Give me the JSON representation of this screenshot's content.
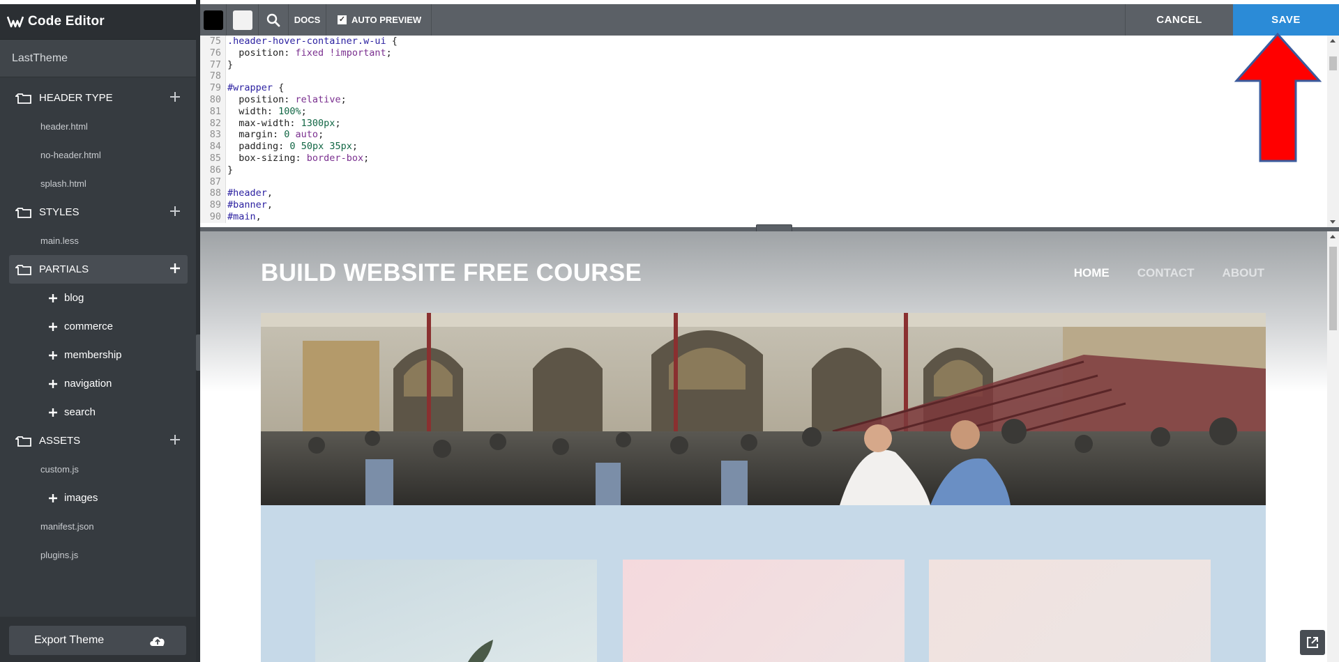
{
  "brand": {
    "title": "Code Editor"
  },
  "sidebar": {
    "theme_name": "LastTheme",
    "sections": [
      {
        "label": "HEADER TYPE",
        "files": [
          "header.html",
          "no-header.html",
          "splash.html"
        ]
      },
      {
        "label": "STYLES",
        "files": [
          "main.less"
        ]
      },
      {
        "label": "PARTIALS",
        "subfolders": [
          "blog",
          "commerce",
          "membership",
          "navigation",
          "search"
        ]
      },
      {
        "label": "ASSETS",
        "files": [
          "custom.js"
        ],
        "subfolders": [
          "images"
        ],
        "files_after": [
          "manifest.json",
          "plugins.js"
        ]
      }
    ],
    "export_label": "Export Theme"
  },
  "toolbar": {
    "docs_label": "DOCS",
    "auto_preview_label": "AUTO PREVIEW",
    "auto_preview_checked": "✓",
    "cancel_label": "CANCEL",
    "save_label": "SAVE",
    "swatch_dark": "#000000",
    "swatch_light": "#f2f2f2"
  },
  "code": {
    "lines": [
      {
        "n": "75",
        "t": ".header-hover-container.w-ui {"
      },
      {
        "n": "76",
        "t": "  position: fixed !important;"
      },
      {
        "n": "77",
        "t": "}"
      },
      {
        "n": "78",
        "t": ""
      },
      {
        "n": "79",
        "t": "#wrapper {"
      },
      {
        "n": "80",
        "t": "  position: relative;"
      },
      {
        "n": "81",
        "t": "  width: 100%;"
      },
      {
        "n": "82",
        "t": "  max-width: 1300px;"
      },
      {
        "n": "83",
        "t": "  margin: 0 auto;"
      },
      {
        "n": "84",
        "t": "  padding: 0 50px 35px;"
      },
      {
        "n": "85",
        "t": "  box-sizing: border-box;"
      },
      {
        "n": "86",
        "t": "}"
      },
      {
        "n": "87",
        "t": ""
      },
      {
        "n": "88",
        "t": "#header,"
      },
      {
        "n": "89",
        "t": "#banner,"
      },
      {
        "n": "90",
        "t": "#main,"
      }
    ]
  },
  "preview": {
    "site_title": "BUILD WEBSITE FREE COURSE",
    "nav": [
      "HOME",
      "CONTACT",
      "ABOUT"
    ]
  },
  "colors": {
    "accent_save": "#2b8bd7",
    "sidebar_bg": "#363b40",
    "annotation_arrow": "#ff0000"
  }
}
